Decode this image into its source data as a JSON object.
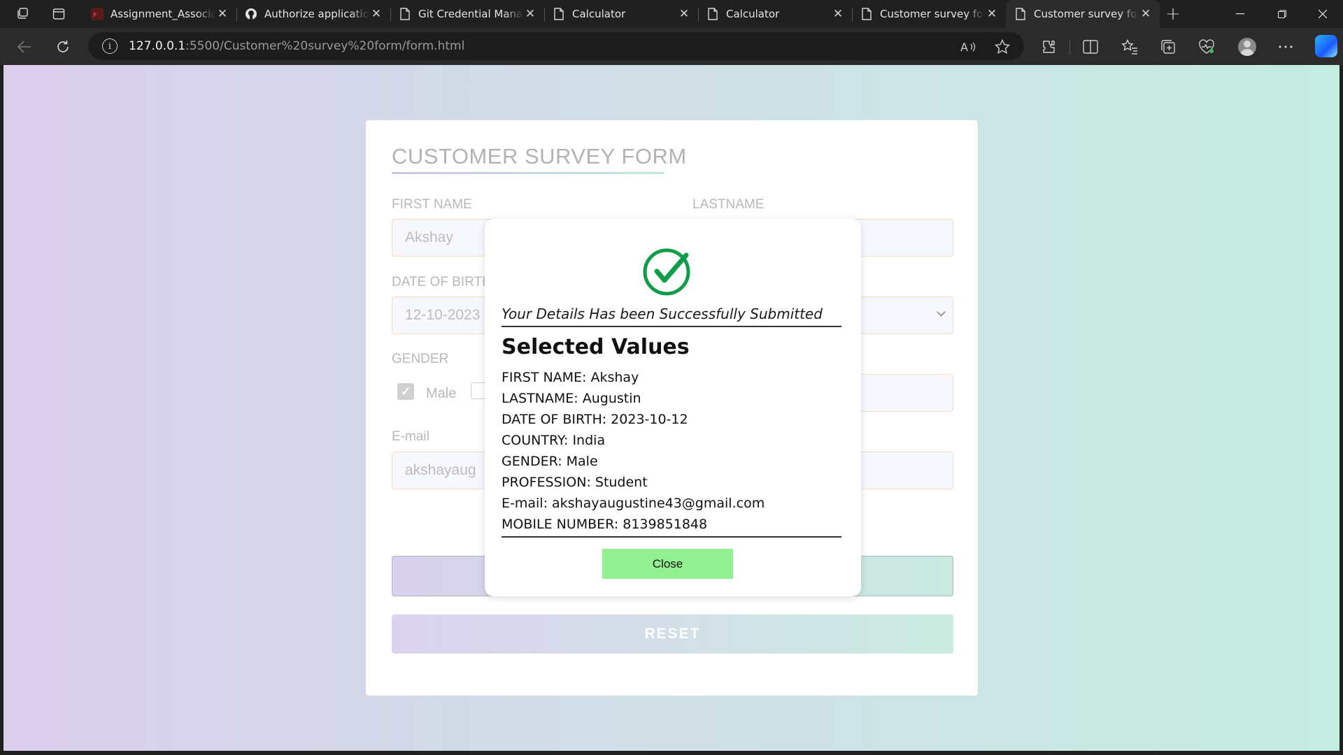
{
  "browser": {
    "tabs": [
      {
        "title": "Assignment_Associat",
        "icon": "pdf-icon",
        "active": false
      },
      {
        "title": "Authorize applicatior",
        "icon": "github-icon",
        "active": false
      },
      {
        "title": "Git Credential Manag",
        "icon": "page-icon",
        "active": false
      },
      {
        "title": "Calculator",
        "icon": "page-icon",
        "active": false
      },
      {
        "title": "Calculator",
        "icon": "page-icon",
        "active": false
      },
      {
        "title": "Customer survey forr",
        "icon": "page-icon",
        "active": false
      },
      {
        "title": "Customer survey forr",
        "icon": "page-icon",
        "active": true
      }
    ],
    "close_glyph": "✕",
    "new_tab_glyph": "+",
    "address": {
      "host": "127.0.0.1",
      "path": ":5500/Customer%20survey%20form/form.html"
    }
  },
  "form": {
    "title": "CUSTOMER SURVEY FORM",
    "first_name_label": "FIRST NAME",
    "first_name_value": "Akshay",
    "last_name_label": "LASTNAME",
    "dob_label": "DATE OF BIRTH",
    "dob_value": "12-10-2023",
    "gender_label": "GENDER",
    "gender_male": "Male",
    "email_label": "E-mail",
    "email_value": "akshayaug",
    "reset_label": "RESET"
  },
  "modal": {
    "message": "Your Details Has been Successfully Submitted",
    "heading": "Selected Values",
    "values": [
      "FIRST NAME: Akshay",
      "LASTNAME: Augustin",
      "DATE OF BIRTH: 2023-10-12",
      "COUNTRY: India",
      "GENDER: Male",
      "PROFESSION: Student",
      "E-mail: akshayaugustine43@gmail.com",
      "MOBILE NUMBER: 8139851848"
    ],
    "close_label": "Close"
  },
  "colors": {
    "success_green": "#0f9d4a",
    "close_button": "#93f091",
    "gradient_start": "#dccfee",
    "gradient_end": "#c4ece0"
  }
}
